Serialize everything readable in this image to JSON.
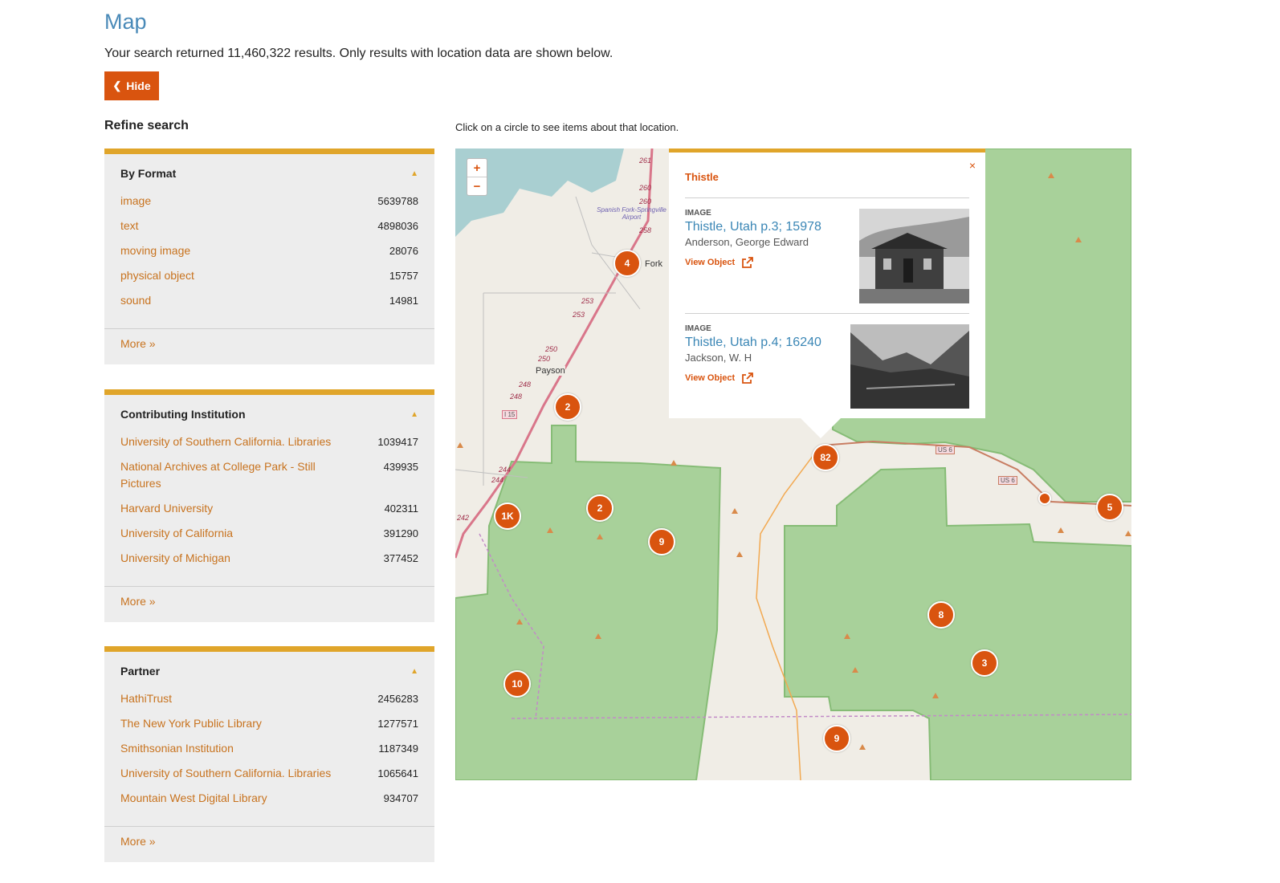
{
  "page": {
    "title": "Map",
    "summary": "Your search returned 11,460,322 results. Only results with location data are shown below.",
    "hide_label": "Hide"
  },
  "refine": {
    "title": "Refine search",
    "facets": [
      {
        "title": "By Format",
        "items": [
          {
            "label": "image",
            "count": "5639788"
          },
          {
            "label": "text",
            "count": "4898036"
          },
          {
            "label": "moving image",
            "count": "28076"
          },
          {
            "label": "physical object",
            "count": "15757"
          },
          {
            "label": "sound",
            "count": "14981"
          }
        ],
        "more": "More »"
      },
      {
        "title": "Contributing Institution",
        "items": [
          {
            "label": "University of Southern California. Libraries",
            "count": "1039417"
          },
          {
            "label": "National Archives at College Park - Still Pictures",
            "count": "439935"
          },
          {
            "label": "Harvard University",
            "count": "402311"
          },
          {
            "label": "University of California",
            "count": "391290"
          },
          {
            "label": "University of Michigan",
            "count": "377452"
          }
        ],
        "more": "More »"
      },
      {
        "title": "Partner",
        "items": [
          {
            "label": "HathiTrust",
            "count": "2456283"
          },
          {
            "label": "The New York Public Library",
            "count": "1277571"
          },
          {
            "label": "Smithsonian Institution",
            "count": "1187349"
          },
          {
            "label": "University of Southern California. Libraries",
            "count": "1065641"
          },
          {
            "label": "Mountain West Digital Library",
            "count": "934707"
          }
        ],
        "more": "More »"
      }
    ]
  },
  "map": {
    "hint": "Click on a circle to see items about that location.",
    "zoom_in": "+",
    "zoom_out": "−",
    "markers": [
      "4",
      "2",
      "2",
      "1K",
      "9",
      "82",
      "5",
      "8",
      "3",
      "10",
      "9"
    ],
    "labels": {
      "airport": "Spanish Fork-Springville Airport",
      "spanish_fork": "Fork",
      "payson": "Payson",
      "i15": "I 15",
      "us6": "US 6",
      "mile_markers": [
        "261",
        "260",
        "260",
        "258",
        "253",
        "253",
        "250",
        "250",
        "248",
        "248",
        "244",
        "244",
        "242"
      ]
    }
  },
  "popup": {
    "title": "Thistle",
    "close": "×",
    "items": [
      {
        "type": "IMAGE",
        "title": "Thistle, Utah p.3; 15978",
        "author": "Anderson, George Edward",
        "view": "View Object"
      },
      {
        "type": "IMAGE",
        "title": "Thistle, Utah p.4; 16240",
        "author": "Jackson, W. H",
        "view": "View Object"
      }
    ]
  },
  "colors": {
    "accent": "#d9540f",
    "gold": "#e0a52a",
    "link": "#3a86b5",
    "facet_link": "#c8731f",
    "forest": "#a8d19a",
    "water": "#a9cfd1"
  }
}
